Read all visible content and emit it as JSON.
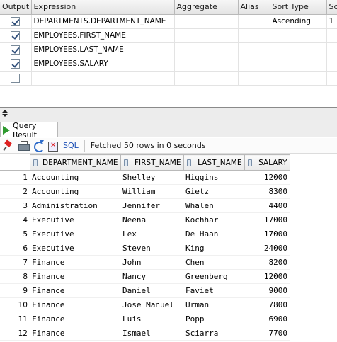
{
  "builder": {
    "columns": [
      "Output",
      "Expression",
      "Aggregate",
      "Alias",
      "Sort Type",
      "So"
    ],
    "rows": [
      {
        "checked": true,
        "expression": "DEPARTMENTS.DEPARTMENT_NAME",
        "aggregate": "",
        "alias": "",
        "sort_type": "Ascending",
        "sort_order": "1"
      },
      {
        "checked": true,
        "expression": "EMPLOYEES.FIRST_NAME",
        "aggregate": "",
        "alias": "",
        "sort_type": "",
        "sort_order": ""
      },
      {
        "checked": true,
        "expression": "EMPLOYEES.LAST_NAME",
        "aggregate": "",
        "alias": "",
        "sort_type": "",
        "sort_order": ""
      },
      {
        "checked": true,
        "expression": "EMPLOYEES.SALARY",
        "aggregate": "",
        "alias": "",
        "sort_type": "",
        "sort_order": ""
      },
      {
        "checked": false,
        "expression": "",
        "aggregate": "",
        "alias": "",
        "sort_type": "",
        "sort_order": ""
      }
    ]
  },
  "tab": {
    "label": "Query Result",
    "icon": "play-icon"
  },
  "toolbar": {
    "icons": [
      "pin-icon",
      "print-icon",
      "refresh-icon",
      "cancel-query-icon"
    ],
    "sql_label": "SQL",
    "status": "Fetched 50 rows in 0 seconds"
  },
  "results": {
    "columns": [
      "DEPARTMENT_NAME",
      "FIRST_NAME",
      "LAST_NAME",
      "SALARY"
    ],
    "rows": [
      {
        "n": "1",
        "dept": "Accounting",
        "first": "Shelley",
        "last": "Higgins",
        "salary": "12000"
      },
      {
        "n": "2",
        "dept": "Accounting",
        "first": "William",
        "last": "Gietz",
        "salary": "8300"
      },
      {
        "n": "3",
        "dept": "Administration",
        "first": "Jennifer",
        "last": "Whalen",
        "salary": "4400"
      },
      {
        "n": "4",
        "dept": "Executive",
        "first": "Neena",
        "last": "Kochhar",
        "salary": "17000"
      },
      {
        "n": "5",
        "dept": "Executive",
        "first": "Lex",
        "last": "De Haan",
        "salary": "17000"
      },
      {
        "n": "6",
        "dept": "Executive",
        "first": "Steven",
        "last": "King",
        "salary": "24000"
      },
      {
        "n": "7",
        "dept": "Finance",
        "first": "John",
        "last": "Chen",
        "salary": "8200"
      },
      {
        "n": "8",
        "dept": "Finance",
        "first": "Nancy",
        "last": "Greenberg",
        "salary": "12000"
      },
      {
        "n": "9",
        "dept": "Finance",
        "first": "Daniel",
        "last": "Faviet",
        "salary": "9000"
      },
      {
        "n": "10",
        "dept": "Finance",
        "first": "Jose Manuel",
        "last": "Urman",
        "salary": "7800"
      },
      {
        "n": "11",
        "dept": "Finance",
        "first": "Luis",
        "last": "Popp",
        "salary": "6900"
      },
      {
        "n": "12",
        "dept": "Finance",
        "first": "Ismael",
        "last": "Sciarra",
        "salary": "7700"
      }
    ]
  }
}
